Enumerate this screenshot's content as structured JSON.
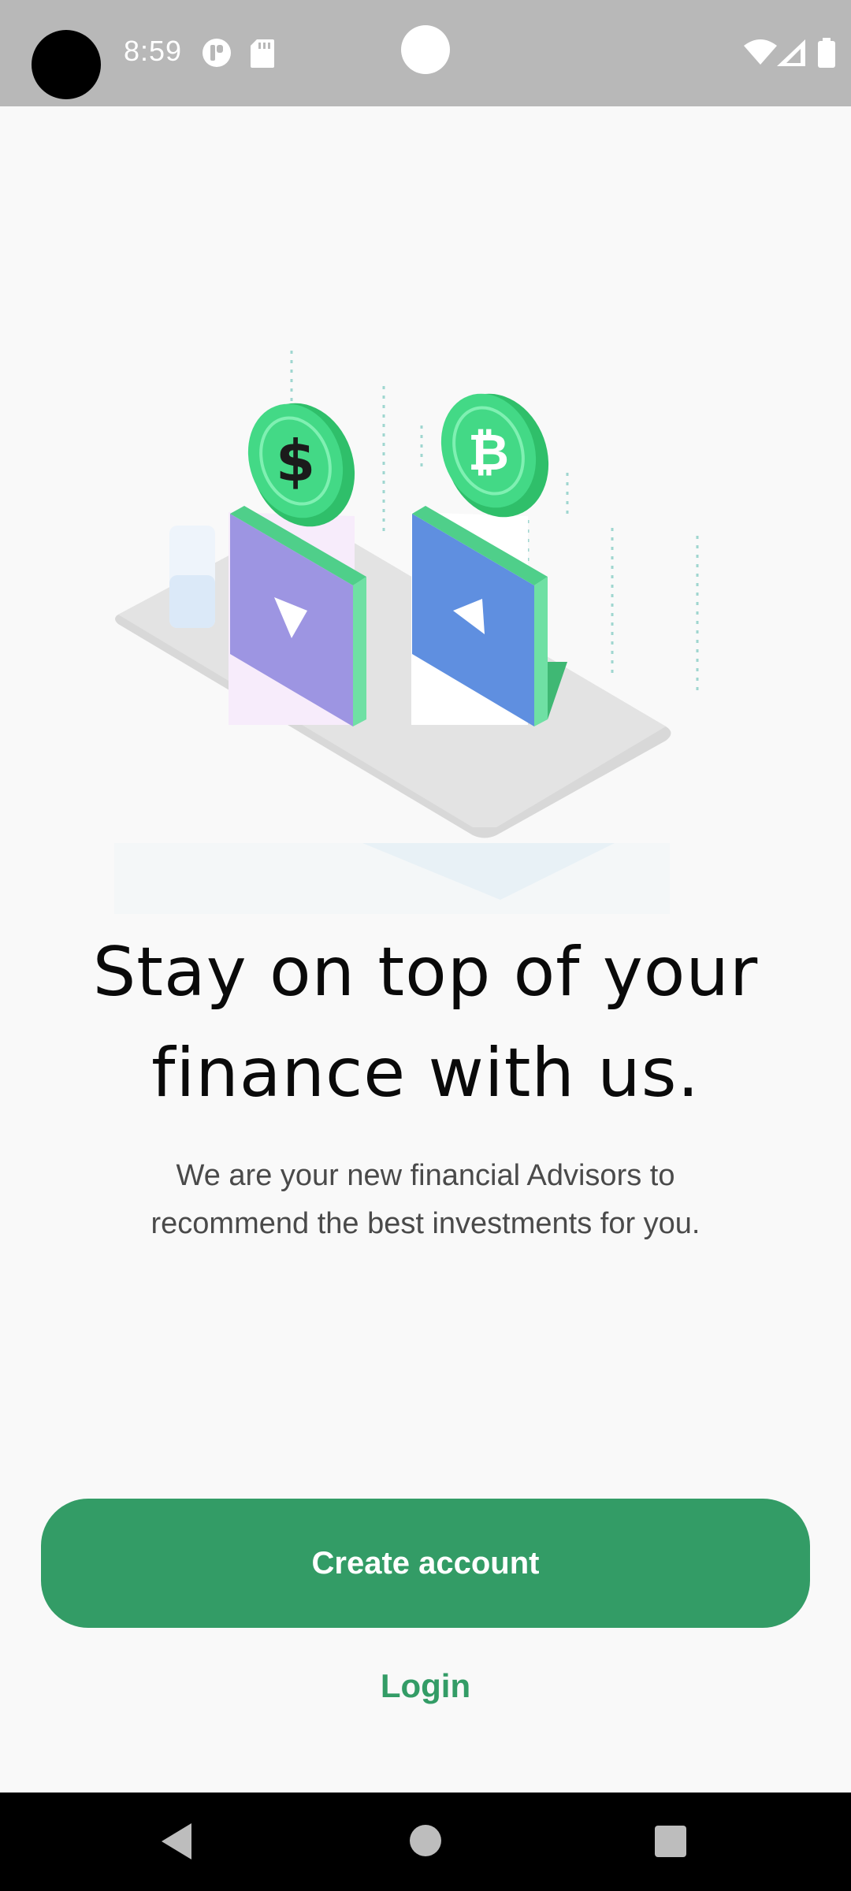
{
  "status_bar": {
    "time": "8:59",
    "icons": [
      "camera-cutout",
      "notification-app-icon",
      "sd-card-icon",
      "wifi-icon",
      "signal-icon",
      "battery-icon"
    ]
  },
  "illustration": {
    "icons": [
      "dollar-coin-icon",
      "bitcoin-coin-icon",
      "play-down-icon",
      "play-up-icon"
    ],
    "colors": {
      "coin_green": "#3ed881",
      "panel_purple": "#9b8fe0",
      "panel_blue": "#5a8ee0",
      "platform_gray": "#dcdcdc"
    }
  },
  "onboarding": {
    "headline": "Stay on top of your finance with us.",
    "subtext": "We are your new financial Advisors to recommend the best investments for you."
  },
  "actions": {
    "create_account_label": "Create account",
    "login_label": "Login",
    "accent_color": "#339c66"
  },
  "nav_bar": {
    "icons": [
      "back-icon",
      "home-icon",
      "recents-icon"
    ]
  }
}
